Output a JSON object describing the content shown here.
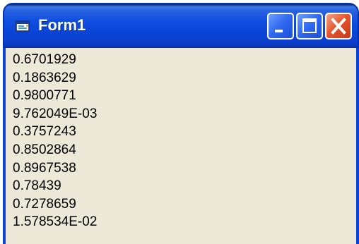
{
  "window": {
    "title": "Form1",
    "icon": "form-icon",
    "controls": {
      "minimize": "minimize-icon",
      "maximize": "maximize-icon",
      "close": "close-icon"
    }
  },
  "output": {
    "lines": [
      "0.6701929",
      "0.1863629",
      "0.9800771",
      "9.762049E-03",
      "0.3757243",
      "0.8502864",
      "0.8967538",
      "0.78439",
      "0.7278659",
      "1.578534E-02"
    ]
  },
  "colors": {
    "titlebar": "#0a43d6",
    "client_background": "#ece9d8",
    "close_button": "#e5562f",
    "text": "#000000"
  }
}
